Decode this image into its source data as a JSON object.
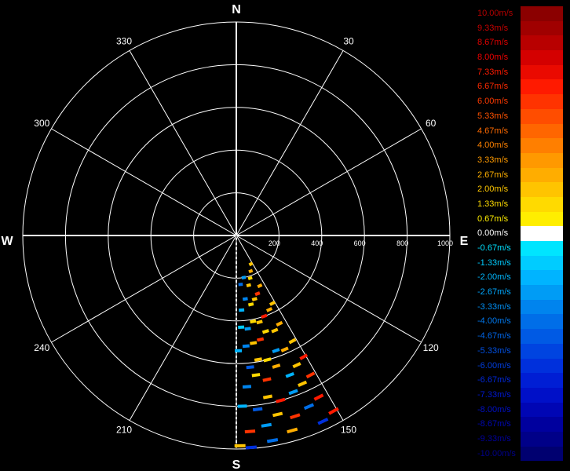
{
  "chart_data": {
    "type": "polar-scatter",
    "radial_axis": {
      "range": [
        0,
        1000
      ],
      "ticks": [
        "200",
        "400",
        "600",
        "800",
        "1000"
      ]
    },
    "angular_axis": {
      "direction": "clockwise",
      "zero": "north",
      "tick_labels": [
        "30",
        "60",
        "120",
        "150",
        "210",
        "240",
        "300",
        "330"
      ],
      "tick_angles": [
        30,
        60,
        120,
        150,
        210,
        240,
        300,
        330
      ],
      "cardinals": {
        "n": "N",
        "e": "E",
        "s": "S",
        "w": "W"
      }
    },
    "grid": true,
    "sector_deg": [
      150,
      180
    ],
    "points": [
      {
        "az": 153,
        "r": 150,
        "v": 2.0
      },
      {
        "az": 158,
        "r": 180,
        "v": 2.67
      },
      {
        "az": 162,
        "r": 210,
        "v": 1.33
      },
      {
        "az": 166,
        "r": 240,
        "v": 2.0
      },
      {
        "az": 170,
        "r": 200,
        "v": -2.67
      },
      {
        "az": 175,
        "r": 230,
        "v": -4.0
      },
      {
        "az": 155,
        "r": 260,
        "v": 2.67
      },
      {
        "az": 160,
        "r": 290,
        "v": 6.0
      },
      {
        "az": 164,
        "r": 310,
        "v": 2.0
      },
      {
        "az": 168,
        "r": 330,
        "v": 1.33
      },
      {
        "az": 172,
        "r": 300,
        "v": -3.33
      },
      {
        "az": 176,
        "r": 350,
        "v": -2.0
      },
      {
        "az": 152,
        "r": 360,
        "v": 2.0
      },
      {
        "az": 156,
        "r": 380,
        "v": 2.67
      },
      {
        "az": 161,
        "r": 400,
        "v": 6.67
      },
      {
        "az": 165,
        "r": 420,
        "v": 2.0
      },
      {
        "az": 169,
        "r": 410,
        "v": 1.33
      },
      {
        "az": 173,
        "r": 440,
        "v": -2.67
      },
      {
        "az": 177,
        "r": 430,
        "v": -1.33
      },
      {
        "az": 154,
        "r": 460,
        "v": 2.67
      },
      {
        "az": 158,
        "r": 480,
        "v": 2.0
      },
      {
        "az": 163,
        "r": 470,
        "v": 1.33
      },
      {
        "az": 167,
        "r": 500,
        "v": 6.0
      },
      {
        "az": 171,
        "r": 510,
        "v": 2.0
      },
      {
        "az": 175,
        "r": 520,
        "v": -3.33
      },
      {
        "az": 179,
        "r": 540,
        "v": -2.0
      },
      {
        "az": 152,
        "r": 560,
        "v": 2.0
      },
      {
        "az": 157,
        "r": 580,
        "v": 2.67
      },
      {
        "az": 161,
        "r": 570,
        "v": -2.67
      },
      {
        "az": 166,
        "r": 600,
        "v": 1.33
      },
      {
        "az": 170,
        "r": 590,
        "v": 2.0
      },
      {
        "az": 174,
        "r": 620,
        "v": -4.67
      },
      {
        "az": 151,
        "r": 650,
        "v": 6.67
      },
      {
        "az": 155,
        "r": 670,
        "v": 2.0
      },
      {
        "az": 159,
        "r": 700,
        "v": -2.0
      },
      {
        "az": 163,
        "r": 640,
        "v": 2.67
      },
      {
        "az": 168,
        "r": 690,
        "v": 6.0
      },
      {
        "az": 172,
        "r": 660,
        "v": 1.33
      },
      {
        "az": 176,
        "r": 710,
        "v": -3.33
      },
      {
        "az": 152,
        "r": 740,
        "v": 6.0
      },
      {
        "az": 156,
        "r": 760,
        "v": 2.0
      },
      {
        "az": 160,
        "r": 780,
        "v": -2.67
      },
      {
        "az": 165,
        "r": 800,
        "v": 6.67
      },
      {
        "az": 169,
        "r": 770,
        "v": 2.0
      },
      {
        "az": 173,
        "r": 820,
        "v": -4.67
      },
      {
        "az": 178,
        "r": 800,
        "v": -2.0
      },
      {
        "az": 153,
        "r": 850,
        "v": 6.67
      },
      {
        "az": 157,
        "r": 870,
        "v": -4.0
      },
      {
        "az": 162,
        "r": 890,
        "v": 6.0
      },
      {
        "az": 167,
        "r": 860,
        "v": 2.0
      },
      {
        "az": 171,
        "r": 900,
        "v": -2.67
      },
      {
        "az": 176,
        "r": 920,
        "v": 6.0
      },
      {
        "az": 151,
        "r": 940,
        "v": 6.67
      },
      {
        "az": 155,
        "r": 960,
        "v": -6.0
      },
      {
        "az": 164,
        "r": 950,
        "v": 2.67
      },
      {
        "az": 170,
        "r": 975,
        "v": -4.0
      },
      {
        "az": 176,
        "r": 995,
        "v": -6.0
      },
      {
        "az": 179,
        "r": 985,
        "v": 2.0
      }
    ]
  },
  "legend": {
    "items": [
      {
        "label": "10.00m/s",
        "color": "#8b0000",
        "text_color": "#b30000"
      },
      {
        "label": "9.33m/s",
        "color": "#a00000",
        "text_color": "#c80000"
      },
      {
        "label": "8.67m/s",
        "color": "#b80000",
        "text_color": "#e00000"
      },
      {
        "label": "8.00m/s",
        "color": "#d40000",
        "text_color": "#f00000"
      },
      {
        "label": "7.33m/s",
        "color": "#ea0a00",
        "text_color": "#ff1a00"
      },
      {
        "label": "6.67m/s",
        "color": "#ff1a00",
        "text_color": "#ff2a00"
      },
      {
        "label": "6.00m/s",
        "color": "#ff3300",
        "text_color": "#ff3a00"
      },
      {
        "label": "5.33m/s",
        "color": "#ff4d00",
        "text_color": "#ff5200"
      },
      {
        "label": "4.67m/s",
        "color": "#ff6600",
        "text_color": "#ff6a00"
      },
      {
        "label": "4.00m/s",
        "color": "#ff7f00",
        "text_color": "#ff8200"
      },
      {
        "label": "3.33m/s",
        "color": "#ff9900",
        "text_color": "#ff9a00"
      },
      {
        "label": "2.67m/s",
        "color": "#ffad00",
        "text_color": "#ffb000"
      },
      {
        "label": "2.00m/s",
        "color": "#ffc400",
        "text_color": "#ffc800"
      },
      {
        "label": "1.33m/s",
        "color": "#ffda00",
        "text_color": "#ffdc00"
      },
      {
        "label": "0.67m/s",
        "color": "#ffee00",
        "text_color": "#ffee00"
      },
      {
        "label": "0.00m/s",
        "color": "#ffffff",
        "text_color": "#ffffff"
      },
      {
        "label": "-0.67m/s",
        "color": "#00e5ff",
        "text_color": "#00e0ff"
      },
      {
        "label": "-1.33m/s",
        "color": "#00ccff",
        "text_color": "#00ccff"
      },
      {
        "label": "-2.00m/s",
        "color": "#00b4ff",
        "text_color": "#00b8ff"
      },
      {
        "label": "-2.67m/s",
        "color": "#009cf5",
        "text_color": "#00a8ff"
      },
      {
        "label": "-3.33m/s",
        "color": "#0084ee",
        "text_color": "#0090f5"
      },
      {
        "label": "-4.00m/s",
        "color": "#006ee8",
        "text_color": "#0078ee"
      },
      {
        "label": "-4.67m/s",
        "color": "#005ae4",
        "text_color": "#0066e8"
      },
      {
        "label": "-5.33m/s",
        "color": "#0044e0",
        "text_color": "#0050e4"
      },
      {
        "label": "-6.00m/s",
        "color": "#0030dc",
        "text_color": "#003ee0"
      },
      {
        "label": "-6.67m/s",
        "color": "#001ed4",
        "text_color": "#0028dc"
      },
      {
        "label": "-7.33m/s",
        "color": "#0010c8",
        "text_color": "#0018d4"
      },
      {
        "label": "-8.00m/s",
        "color": "#0006b4",
        "text_color": "#0010c8"
      },
      {
        "label": "-8.67m/s",
        "color": "#00009e",
        "text_color": "#0008b4"
      },
      {
        "label": "-9.33m/s",
        "color": "#000088",
        "text_color": "#00009e"
      },
      {
        "label": "-10.00m/s",
        "color": "#000070",
        "text_color": "#000088"
      }
    ]
  },
  "colors": {
    "background": "#000000",
    "grid": "#ffffff"
  }
}
